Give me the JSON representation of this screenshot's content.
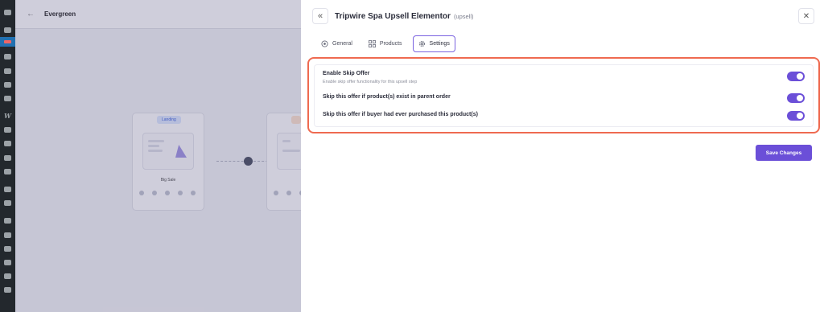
{
  "canvas": {
    "title": "Evergreen",
    "nodes": [
      {
        "tag": "Landing",
        "name": "Big Sale"
      },
      {
        "tag": "",
        "name": ""
      }
    ]
  },
  "drawer": {
    "title": "Tripwire Spa Upsell Elementor",
    "subtitle": "(upsell)",
    "tabs": [
      {
        "label": "General",
        "icon": "circle-icon"
      },
      {
        "label": "Products",
        "icon": "grid-icon"
      },
      {
        "label": "Settings",
        "icon": "gear-icon",
        "active": true
      }
    ],
    "settings": [
      {
        "label": "Enable Skip Offer",
        "description": "Enable skip offer functionality for this upsell step",
        "enabled": true
      },
      {
        "label": "Skip this offer if product(s) exist in parent order",
        "enabled": true
      },
      {
        "label": "Skip this offer if buyer had ever purchased this product(s)",
        "enabled": true
      }
    ],
    "save_label": "Save Changes"
  },
  "colors": {
    "accent": "#6b4fd8",
    "highlight_border": "#ef6a50",
    "sidebar": "#23282d"
  }
}
